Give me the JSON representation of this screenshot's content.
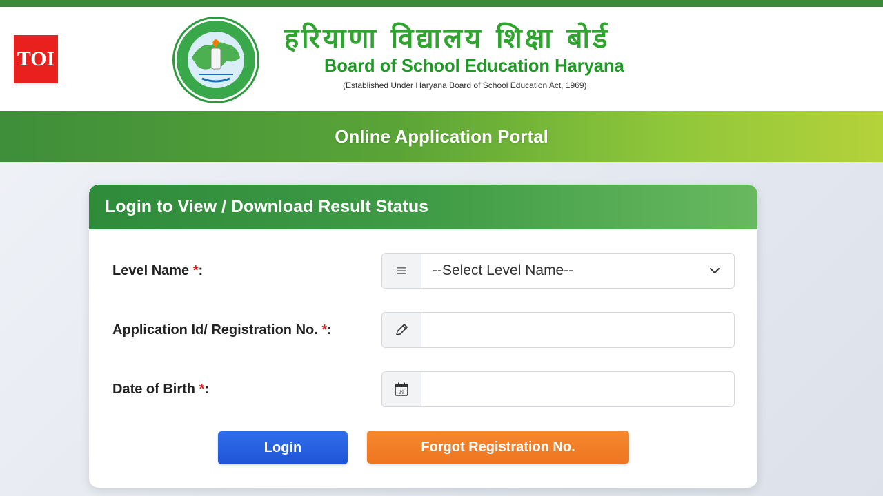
{
  "toi": {
    "label": "TOI",
    "color": "#e8201e"
  },
  "header": {
    "hindi_title": "हरियाणा विद्यालय शिक्षा बोर्ड",
    "english_title": "Board of School Education Haryana",
    "established": "(Established Under Haryana Board of School Education Act, 1969)",
    "emblem_icon": "bseh-emblem-icon"
  },
  "portal": {
    "title": "Online Application Portal"
  },
  "card": {
    "title": "Login to View / Download Result Status"
  },
  "form": {
    "level": {
      "label": "Level Name ",
      "required": "*",
      "colon": ":",
      "selected": "--Select Level Name--",
      "icon": "list-icon"
    },
    "application_id": {
      "label": "Application Id/ Registration No. ",
      "required": "*",
      "colon": ":",
      "value": "",
      "icon": "pencil-icon"
    },
    "dob": {
      "label": "Date of Birth ",
      "required": "*",
      "colon": ":",
      "value": "",
      "icon": "calendar-icon",
      "calendar_day": "19"
    }
  },
  "buttons": {
    "login": "Login",
    "forgot": "Forgot Registration No."
  },
  "colors": {
    "accent_green": "#2e8b3a",
    "login_blue": "#1f55d8",
    "forgot_orange": "#ee7620",
    "required_red": "#d42020"
  }
}
